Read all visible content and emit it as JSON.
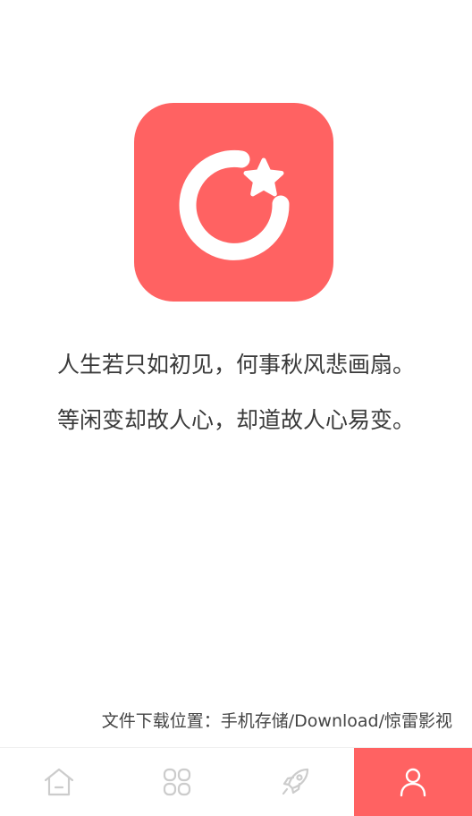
{
  "poem": {
    "line1": "人生若只如初见，何事秋风悲画扇。",
    "line2": "等闲变却故人心，却道故人心易变。"
  },
  "download_path": "文件下载位置：手机存储/Download/惊雷影视",
  "logo": {
    "icon": "moon-star-logo",
    "color": "#ff6262"
  },
  "tab_bar": {
    "active_tab": "profile",
    "accent_color": "#ff6262",
    "inactive_icon_color": "#cccccc",
    "tabs": [
      {
        "id": "home",
        "icon": "home-icon"
      },
      {
        "id": "categories",
        "icon": "grid-icon"
      },
      {
        "id": "discover",
        "icon": "rocket-icon"
      },
      {
        "id": "profile",
        "icon": "user-icon"
      }
    ]
  }
}
